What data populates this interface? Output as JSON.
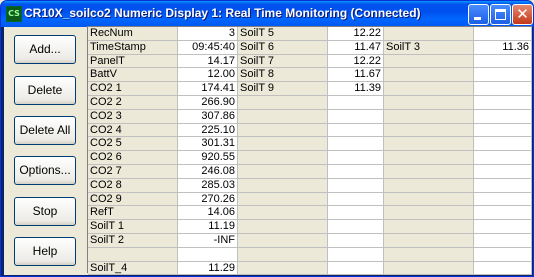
{
  "window": {
    "title": "CR10X_soilco2 Numeric Display 1: Real Time Monitoring (Connected)",
    "app_icon_text": "CS"
  },
  "buttons": [
    {
      "label": "Add..."
    },
    {
      "label": "Delete"
    },
    {
      "label": "Delete All"
    },
    {
      "label": "Options..."
    },
    {
      "label": "Stop"
    },
    {
      "label": "Help"
    }
  ],
  "grid": {
    "columns": [
      [
        {
          "label": "RecNum",
          "value": "3"
        },
        {
          "label": "TimeStamp",
          "value": "09:45:40"
        },
        {
          "label": "PanelT",
          "value": "14.17"
        },
        {
          "label": "BattV",
          "value": "12.00"
        },
        {
          "label": "CO2  1",
          "value": "174.41"
        },
        {
          "label": "CO2  2",
          "value": "266.90"
        },
        {
          "label": "CO2  3",
          "value": "307.86"
        },
        {
          "label": "CO2  4",
          "value": "225.10"
        },
        {
          "label": "CO2  5",
          "value": "301.31"
        },
        {
          "label": "CO2  6",
          "value": "920.55"
        },
        {
          "label": "CO2  7",
          "value": "246.08"
        },
        {
          "label": "CO2  8",
          "value": "285.03"
        },
        {
          "label": "CO2  9",
          "value": "270.26"
        },
        {
          "label": "RefT",
          "value": "14.06"
        },
        {
          "label": "SoilT  1",
          "value": "11.19"
        },
        {
          "label": "SoilT  2",
          "value": "-INF"
        },
        {
          "label": "",
          "value": ""
        },
        {
          "label": "SoilT_4",
          "value": "11.29"
        }
      ],
      [
        {
          "label": "SoilT  5",
          "value": "12.22"
        },
        {
          "label": "SoilT  6",
          "value": "11.47"
        },
        {
          "label": "SoilT  7",
          "value": "12.22"
        },
        {
          "label": "SoilT  8",
          "value": "11.67"
        },
        {
          "label": "SoilT  9",
          "value": "11.39"
        },
        {
          "label": "",
          "value": ""
        },
        {
          "label": "",
          "value": ""
        },
        {
          "label": "",
          "value": ""
        },
        {
          "label": "",
          "value": ""
        },
        {
          "label": "",
          "value": ""
        },
        {
          "label": "",
          "value": ""
        },
        {
          "label": "",
          "value": ""
        },
        {
          "label": "",
          "value": ""
        },
        {
          "label": "",
          "value": ""
        },
        {
          "label": "",
          "value": ""
        },
        {
          "label": "",
          "value": ""
        },
        {
          "label": "",
          "value": ""
        },
        {
          "label": "",
          "value": ""
        }
      ],
      [
        {
          "label": "",
          "value": ""
        },
        {
          "label": "SoilT  3",
          "value": "11.36"
        },
        {
          "label": "",
          "value": ""
        },
        {
          "label": "",
          "value": ""
        },
        {
          "label": "",
          "value": ""
        },
        {
          "label": "",
          "value": ""
        },
        {
          "label": "",
          "value": ""
        },
        {
          "label": "",
          "value": ""
        },
        {
          "label": "",
          "value": ""
        },
        {
          "label": "",
          "value": ""
        },
        {
          "label": "",
          "value": ""
        },
        {
          "label": "",
          "value": ""
        },
        {
          "label": "",
          "value": ""
        },
        {
          "label": "",
          "value": ""
        },
        {
          "label": "",
          "value": ""
        },
        {
          "label": "",
          "value": ""
        },
        {
          "label": "",
          "value": ""
        },
        {
          "label": "",
          "value": ""
        }
      ]
    ]
  }
}
